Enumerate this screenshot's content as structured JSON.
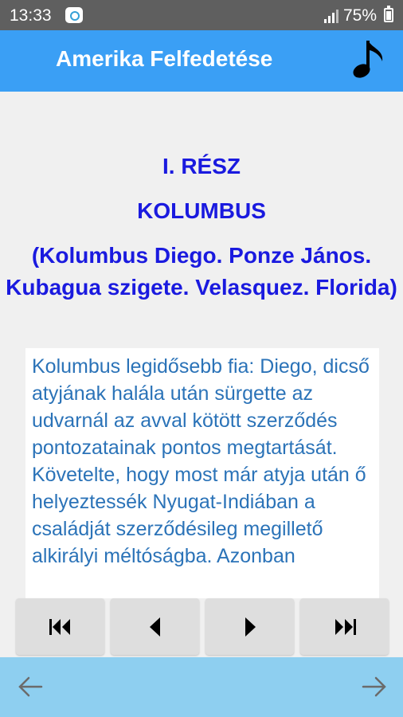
{
  "status_bar": {
    "time": "13:33",
    "battery_text": "75%"
  },
  "app_bar": {
    "title": "Amerika Felfedetése",
    "music_icon": "music-note-icon"
  },
  "content": {
    "part": "I. RÉSZ",
    "chapter": "KOLUMBUS",
    "subtitle": "(Kolumbus Diego. Ponze János. Kubagua szigete. Velasquez. Florida)",
    "body": "Kolumbus legidősebb fia: Diego, dicső atyjának halála után sürgette az udvarnál az avval kötött szerződés pontozatainak pontos megtartását. Követelte, hogy most már atyja után ő helyeztessék Nyugat-Indiában a családját szerződésileg megillető alkirályi méltóságba. Azonban"
  },
  "player_controls": [
    {
      "name": "skip-to-start-button",
      "icon": "skip-start-icon"
    },
    {
      "name": "previous-button",
      "icon": "play-reverse-icon"
    },
    {
      "name": "play-button",
      "icon": "play-icon"
    },
    {
      "name": "skip-to-end-button",
      "icon": "skip-end-icon"
    }
  ],
  "bottom_nav": {
    "back_icon": "arrow-left-icon",
    "forward_icon": "arrow-right-icon"
  },
  "colors": {
    "app_bar": "#3a9ff5",
    "heading": "#1a1adf",
    "body_text": "#2b73b8",
    "bottom_bar": "#8ecff0"
  }
}
